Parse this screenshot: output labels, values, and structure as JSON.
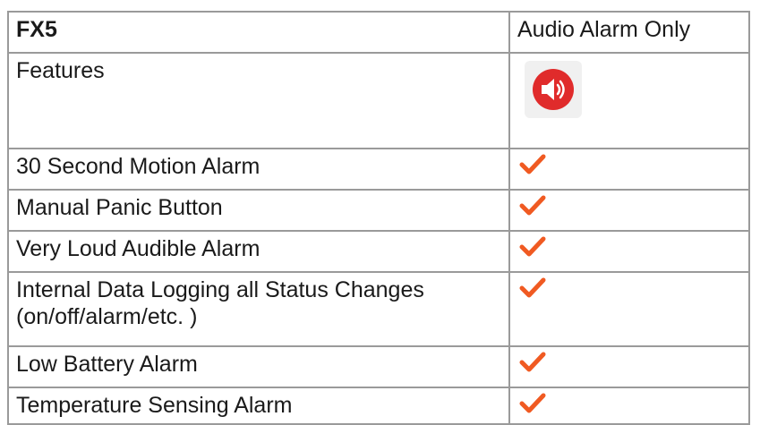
{
  "table": {
    "header": {
      "model": "FX5",
      "option": "Audio Alarm Only"
    },
    "features_label": "Features",
    "feature_icon": "speaker-alarm-icon",
    "check_icon": "checkmark-icon",
    "colors": {
      "check": "#f05a22",
      "speaker_circle": "#e02b2b",
      "border": "#9a9a9a"
    },
    "rows": [
      {
        "feature": "30 Second Motion Alarm",
        "included": true
      },
      {
        "feature": "Manual Panic Button",
        "included": true
      },
      {
        "feature": "Very Loud Audible Alarm",
        "included": true
      },
      {
        "feature": "Internal Data Logging all Status Changes (on/off/alarm/etc. )",
        "included": true
      },
      {
        "feature": "Low Battery Alarm",
        "included": true
      },
      {
        "feature": "Temperature Sensing Alarm",
        "included": true
      }
    ]
  }
}
